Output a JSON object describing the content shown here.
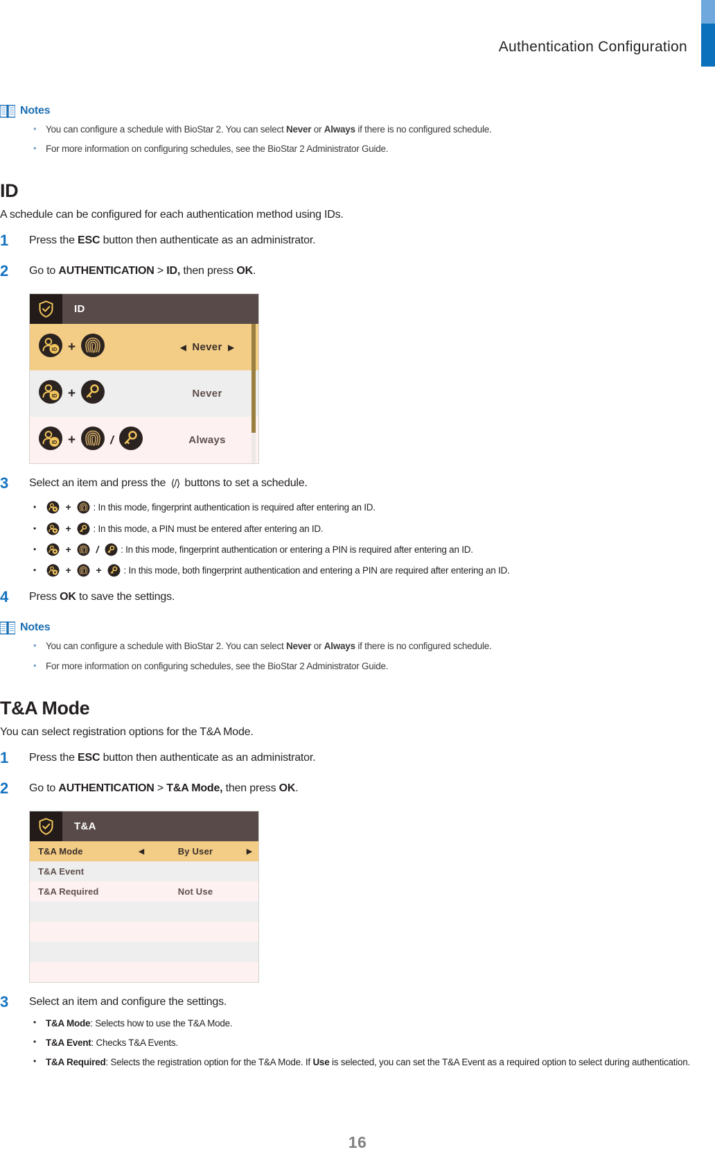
{
  "header": {
    "title": "Authentication  Configuration",
    "accent_light": "#6fa8dc",
    "accent_dark": "#0b71bd"
  },
  "notes_top": {
    "label": "Notes",
    "icon": "book-icon",
    "items": [
      "You can configure a schedule with BioStar 2. You can select Never or Always if there is no configured schedule.",
      "For more information on configuring schedules, see the BioStar 2 Administrator Guide."
    ]
  },
  "id_section": {
    "heading": "ID",
    "description": "A schedule can be configured for each authentication method using IDs.",
    "steps": [
      {
        "num": "1",
        "text": "Press the ESC button then authenticate as an administrator."
      },
      {
        "num": "2",
        "text": "Go to AUTHENTICATION > ID, then press OK."
      },
      {
        "num": "3",
        "text": "Select an item and press the ‹/› buttons to set a schedule."
      },
      {
        "num": "4",
        "text": "Press OK to save the settings."
      }
    ],
    "device": {
      "title": "ID",
      "title_icon": "shield-check-icon",
      "rows": [
        {
          "icons": [
            "id-card-user-icon",
            "fingerprint-icon"
          ],
          "operators": [
            "+"
          ],
          "value": "Never",
          "selected": true,
          "show_arrows": true
        },
        {
          "icons": [
            "id-card-user-icon",
            "key-icon"
          ],
          "operators": [
            "+"
          ],
          "value": "Never",
          "selected": false,
          "show_arrows": false
        },
        {
          "icons": [
            "id-card-user-icon",
            "fingerprint-icon",
            "key-icon"
          ],
          "operators": [
            "+",
            "/"
          ],
          "value": "Always",
          "selected": false,
          "show_arrows": false
        }
      ]
    },
    "mode_bullets": [
      ": In this mode, fingerprint authentication is required after entering an ID.",
      ": In this mode, a PIN must be entered after entering an ID.",
      ": In this mode, fingerprint authentication or entering a PIN is required after entering an ID.",
      ": In this mode, both fingerprint authentication and entering a PIN are required after entering an ID."
    ]
  },
  "notes_bottom": {
    "label": "Notes",
    "icon": "book-icon",
    "items": [
      "You can configure a schedule with BioStar 2. You can select Never or Always if there is no configured schedule.",
      "For more information on configuring schedules, see the BioStar 2 Administrator Guide."
    ]
  },
  "ta_section": {
    "heading": "T&A Mode",
    "description": "You can select registration options for the T&A Mode.",
    "steps": [
      {
        "num": "1",
        "text": "Press the ESC button then authenticate as an administrator."
      },
      {
        "num": "2",
        "text": "Go to AUTHENTICATION > T&A Mode, then press OK."
      },
      {
        "num": "3",
        "text": "Select an item and configure the settings."
      }
    ],
    "device": {
      "title": "T&A",
      "title_icon": "shield-check-icon",
      "rows": [
        {
          "label": "T&A Mode",
          "value": "By User",
          "selected": true,
          "show_arrows": true,
          "shade": "sel"
        },
        {
          "label": "T&A Event",
          "value": "",
          "selected": false,
          "show_arrows": false,
          "shade": "grey"
        },
        {
          "label": "T&A Required",
          "value": "Not Use",
          "selected": false,
          "show_arrows": false,
          "shade": "pink"
        },
        {
          "label": "",
          "value": "",
          "selected": false,
          "show_arrows": false,
          "shade": "grey"
        },
        {
          "label": "",
          "value": "",
          "selected": false,
          "show_arrows": false,
          "shade": "pink"
        },
        {
          "label": "",
          "value": "",
          "selected": false,
          "show_arrows": false,
          "shade": "grey"
        },
        {
          "label": "",
          "value": "",
          "selected": false,
          "show_arrows": false,
          "shade": "pink"
        }
      ]
    },
    "settings_bullets": [
      {
        "term": "T&A Mode",
        "rest": ": Selects how to use the T&A Mode."
      },
      {
        "term": "T&A Event",
        "rest": ": Checks T&A Events."
      },
      {
        "term": "T&A Required",
        "rest": ": Selects the registration option for the T&A Mode. If Use is selected, you can set the T&A Event as a required option to select during authentication."
      }
    ]
  },
  "footer": {
    "page_number": "16"
  }
}
